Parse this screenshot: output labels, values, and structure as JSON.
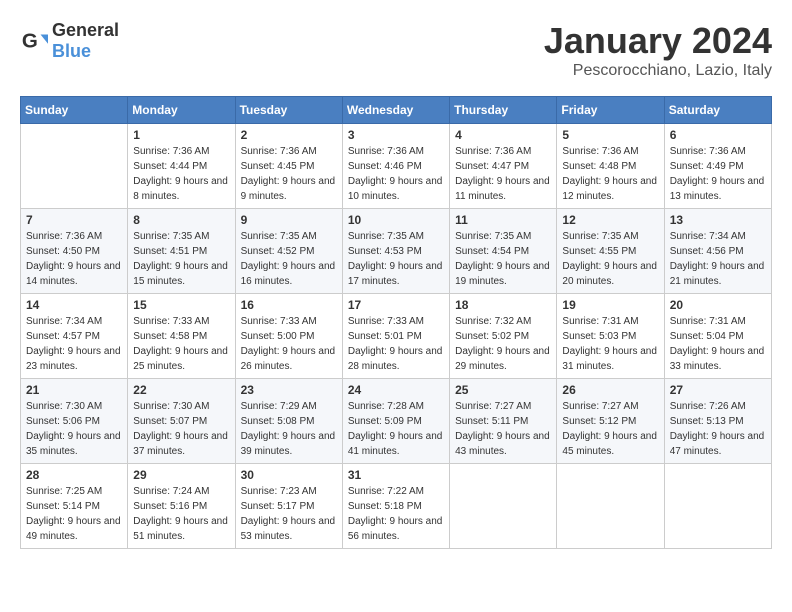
{
  "header": {
    "logo_general": "General",
    "logo_blue": "Blue",
    "title": "January 2024",
    "location": "Pescorocchiano, Lazio, Italy"
  },
  "weekdays": [
    "Sunday",
    "Monday",
    "Tuesday",
    "Wednesday",
    "Thursday",
    "Friday",
    "Saturday"
  ],
  "weeks": [
    [
      {
        "day": "",
        "info": ""
      },
      {
        "day": "1",
        "info": "Sunrise: 7:36 AM\nSunset: 4:44 PM\nDaylight: 9 hours\nand 8 minutes."
      },
      {
        "day": "2",
        "info": "Sunrise: 7:36 AM\nSunset: 4:45 PM\nDaylight: 9 hours\nand 9 minutes."
      },
      {
        "day": "3",
        "info": "Sunrise: 7:36 AM\nSunset: 4:46 PM\nDaylight: 9 hours\nand 10 minutes."
      },
      {
        "day": "4",
        "info": "Sunrise: 7:36 AM\nSunset: 4:47 PM\nDaylight: 9 hours\nand 11 minutes."
      },
      {
        "day": "5",
        "info": "Sunrise: 7:36 AM\nSunset: 4:48 PM\nDaylight: 9 hours\nand 12 minutes."
      },
      {
        "day": "6",
        "info": "Sunrise: 7:36 AM\nSunset: 4:49 PM\nDaylight: 9 hours\nand 13 minutes."
      }
    ],
    [
      {
        "day": "7",
        "info": "Sunrise: 7:36 AM\nSunset: 4:50 PM\nDaylight: 9 hours\nand 14 minutes."
      },
      {
        "day": "8",
        "info": "Sunrise: 7:35 AM\nSunset: 4:51 PM\nDaylight: 9 hours\nand 15 minutes."
      },
      {
        "day": "9",
        "info": "Sunrise: 7:35 AM\nSunset: 4:52 PM\nDaylight: 9 hours\nand 16 minutes."
      },
      {
        "day": "10",
        "info": "Sunrise: 7:35 AM\nSunset: 4:53 PM\nDaylight: 9 hours\nand 17 minutes."
      },
      {
        "day": "11",
        "info": "Sunrise: 7:35 AM\nSunset: 4:54 PM\nDaylight: 9 hours\nand 19 minutes."
      },
      {
        "day": "12",
        "info": "Sunrise: 7:35 AM\nSunset: 4:55 PM\nDaylight: 9 hours\nand 20 minutes."
      },
      {
        "day": "13",
        "info": "Sunrise: 7:34 AM\nSunset: 4:56 PM\nDaylight: 9 hours\nand 21 minutes."
      }
    ],
    [
      {
        "day": "14",
        "info": "Sunrise: 7:34 AM\nSunset: 4:57 PM\nDaylight: 9 hours\nand 23 minutes."
      },
      {
        "day": "15",
        "info": "Sunrise: 7:33 AM\nSunset: 4:58 PM\nDaylight: 9 hours\nand 25 minutes."
      },
      {
        "day": "16",
        "info": "Sunrise: 7:33 AM\nSunset: 5:00 PM\nDaylight: 9 hours\nand 26 minutes."
      },
      {
        "day": "17",
        "info": "Sunrise: 7:33 AM\nSunset: 5:01 PM\nDaylight: 9 hours\nand 28 minutes."
      },
      {
        "day": "18",
        "info": "Sunrise: 7:32 AM\nSunset: 5:02 PM\nDaylight: 9 hours\nand 29 minutes."
      },
      {
        "day": "19",
        "info": "Sunrise: 7:31 AM\nSunset: 5:03 PM\nDaylight: 9 hours\nand 31 minutes."
      },
      {
        "day": "20",
        "info": "Sunrise: 7:31 AM\nSunset: 5:04 PM\nDaylight: 9 hours\nand 33 minutes."
      }
    ],
    [
      {
        "day": "21",
        "info": "Sunrise: 7:30 AM\nSunset: 5:06 PM\nDaylight: 9 hours\nand 35 minutes."
      },
      {
        "day": "22",
        "info": "Sunrise: 7:30 AM\nSunset: 5:07 PM\nDaylight: 9 hours\nand 37 minutes."
      },
      {
        "day": "23",
        "info": "Sunrise: 7:29 AM\nSunset: 5:08 PM\nDaylight: 9 hours\nand 39 minutes."
      },
      {
        "day": "24",
        "info": "Sunrise: 7:28 AM\nSunset: 5:09 PM\nDaylight: 9 hours\nand 41 minutes."
      },
      {
        "day": "25",
        "info": "Sunrise: 7:27 AM\nSunset: 5:11 PM\nDaylight: 9 hours\nand 43 minutes."
      },
      {
        "day": "26",
        "info": "Sunrise: 7:27 AM\nSunset: 5:12 PM\nDaylight: 9 hours\nand 45 minutes."
      },
      {
        "day": "27",
        "info": "Sunrise: 7:26 AM\nSunset: 5:13 PM\nDaylight: 9 hours\nand 47 minutes."
      }
    ],
    [
      {
        "day": "28",
        "info": "Sunrise: 7:25 AM\nSunset: 5:14 PM\nDaylight: 9 hours\nand 49 minutes."
      },
      {
        "day": "29",
        "info": "Sunrise: 7:24 AM\nSunset: 5:16 PM\nDaylight: 9 hours\nand 51 minutes."
      },
      {
        "day": "30",
        "info": "Sunrise: 7:23 AM\nSunset: 5:17 PM\nDaylight: 9 hours\nand 53 minutes."
      },
      {
        "day": "31",
        "info": "Sunrise: 7:22 AM\nSunset: 5:18 PM\nDaylight: 9 hours\nand 56 minutes."
      },
      {
        "day": "",
        "info": ""
      },
      {
        "day": "",
        "info": ""
      },
      {
        "day": "",
        "info": ""
      }
    ]
  ]
}
